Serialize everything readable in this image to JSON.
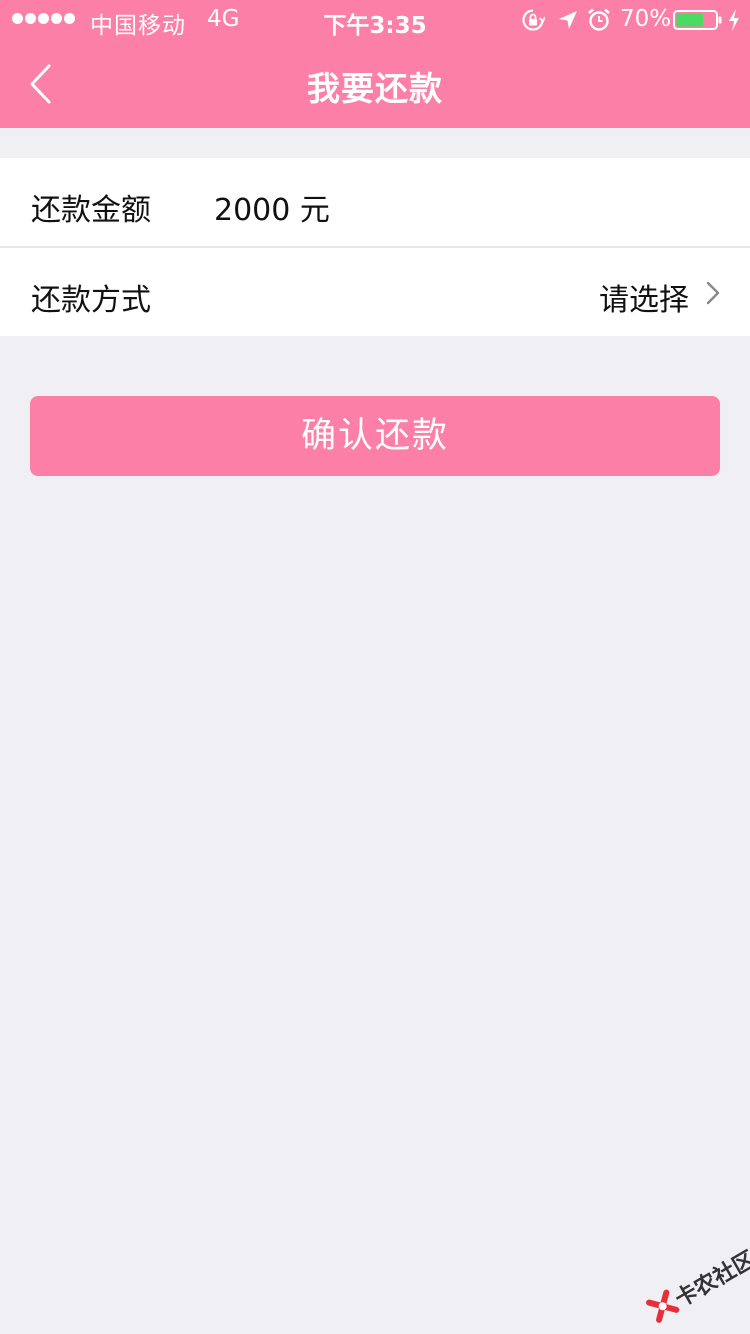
{
  "status_bar": {
    "carrier": "中国移动",
    "network": "4G",
    "time": "下午3:35",
    "battery_percent": "70%",
    "battery_level": 0.7
  },
  "nav": {
    "title": "我要还款",
    "back_icon": "chevron-left-icon"
  },
  "form": {
    "amount_label": "还款金额",
    "amount_value": "2000 元",
    "method_label": "还款方式",
    "method_placeholder": "请选择",
    "method_icon": "chevron-right-icon"
  },
  "confirm_button_label": "确认还款",
  "watermark": "卡农社区",
  "colors": {
    "brand": "#FC7FA8",
    "background": "#EFEFF4",
    "divider": "#E6E6EA",
    "battery_green": "#4CD964",
    "watermark_red": "#E4303A"
  }
}
